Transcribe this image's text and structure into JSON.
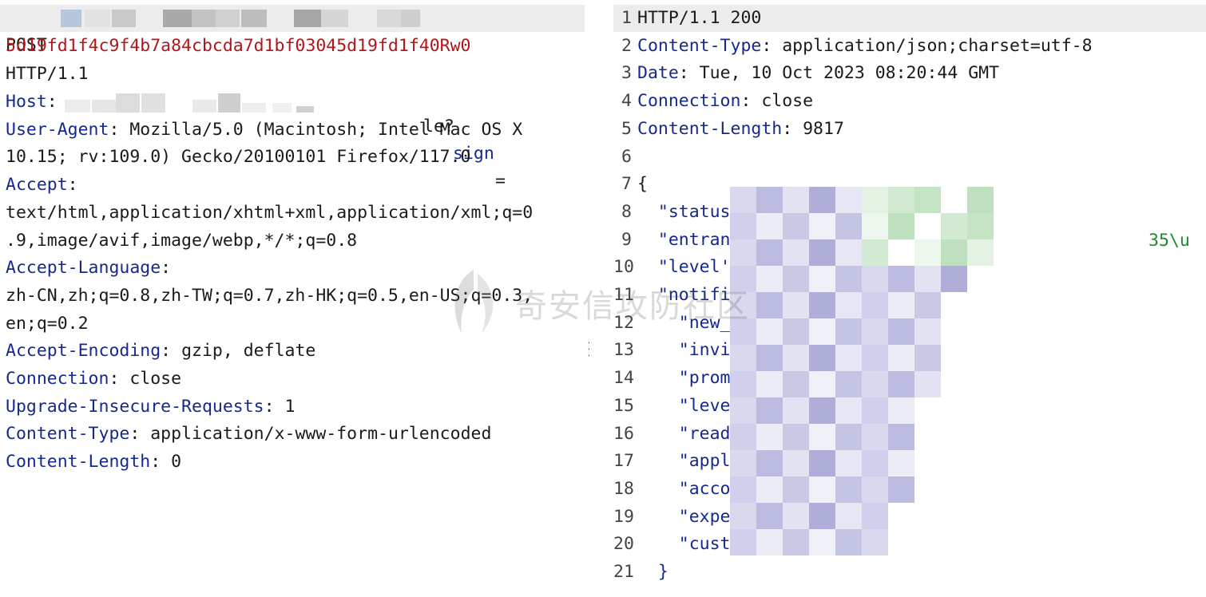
{
  "request": {
    "method": "POST",
    "url_suffix": "le?",
    "sign_param": "sign",
    "equals": "=",
    "sign_value": "5d19fd1f4c9f4b7a84cbcda7d1bf03045d19fd1f40Rw0",
    "protocol": "HTTP/1.1",
    "headers": [
      {
        "key": "Host",
        "sep": ":",
        "value": ""
      },
      {
        "key": "User-Agent",
        "sep": ":",
        "value": " Mozilla/5.0 (Macintosh; Intel Mac OS X"
      },
      {
        "key": "",
        "sep": "",
        "value": "10.15; rv:109.0) Gecko/20100101 Firefox/117.0"
      },
      {
        "key": "Accept",
        "sep": ":",
        "value": ""
      },
      {
        "key": "",
        "sep": "",
        "value": "text/html,application/xhtml+xml,application/xml;q=0"
      },
      {
        "key": "",
        "sep": "",
        "value": ".9,image/avif,image/webp,*/*;q=0.8"
      },
      {
        "key": "Accept-Language",
        "sep": ":",
        "value": ""
      },
      {
        "key": "",
        "sep": "",
        "value": "zh-CN,zh;q=0.8,zh-TW;q=0.7,zh-HK;q=0.5,en-US;q=0.3,"
      },
      {
        "key": "",
        "sep": "",
        "value": "en;q=0.2"
      },
      {
        "key": "Accept-Encoding",
        "sep": ":",
        "value": " gzip, deflate"
      },
      {
        "key": "Connection",
        "sep": ":",
        "value": " close"
      },
      {
        "key": "Upgrade-Insecure-Requests",
        "sep": ":",
        "value": " 1"
      },
      {
        "key": "Content-Type",
        "sep": ":",
        "value": " application/x-www-form-urlencoded"
      },
      {
        "key": "Content-Length",
        "sep": ":",
        "value": " 0"
      }
    ]
  },
  "response": {
    "lines": [
      {
        "n": "1",
        "key": "",
        "sep": "",
        "value": "HTTP/1.1 200"
      },
      {
        "n": "2",
        "key": "Content-Type",
        "sep": ":",
        "value": " application/json;charset=utf-8"
      },
      {
        "n": "3",
        "key": "Date",
        "sep": ":",
        "value": " Tue, 10 Oct 2023 08:20:44 GMT"
      },
      {
        "n": "4",
        "key": "Connection",
        "sep": ":",
        "value": " close"
      },
      {
        "n": "5",
        "key": "Content-Length",
        "sep": ":",
        "value": " 9817"
      },
      {
        "n": "6",
        "key": "",
        "sep": "",
        "value": ""
      },
      {
        "n": "7",
        "key": "",
        "sep": "",
        "value": "{"
      },
      {
        "n": "8",
        "key": "  \"status",
        "sep": "",
        "value": ""
      },
      {
        "n": "9",
        "key": "  \"entran",
        "sep": "",
        "value": ""
      },
      {
        "n": "10",
        "key": "  \"level'",
        "sep": "",
        "value": ""
      },
      {
        "n": "11",
        "key": "  \"notifi",
        "sep": "",
        "value": ""
      },
      {
        "n": "12",
        "key": "    \"new_",
        "sep": "",
        "value": ""
      },
      {
        "n": "13",
        "key": "    \"invi",
        "sep": "",
        "value": ""
      },
      {
        "n": "14",
        "key": "    \"prom",
        "sep": "",
        "value": ""
      },
      {
        "n": "15",
        "key": "    \"leve",
        "sep": "",
        "value": ""
      },
      {
        "n": "16",
        "key": "    \"read",
        "sep": "",
        "value": ""
      },
      {
        "n": "17",
        "key": "    \"appl",
        "sep": "",
        "value": ""
      },
      {
        "n": "18",
        "key": "    \"acco",
        "sep": "",
        "value": ""
      },
      {
        "n": "19",
        "key": "    \"expe",
        "sep": "",
        "value": ""
      },
      {
        "n": "20",
        "key": "    \"cust",
        "sep": "",
        "value": ""
      },
      {
        "n": "21",
        "key": "  }",
        "sep": "",
        "value": ""
      }
    ],
    "visible_fragment_line9": "35\\u"
  },
  "watermark": {
    "text": "奇安信攻防社区"
  },
  "colors": {
    "key": "#16288f",
    "sign": "#b3161a",
    "string": "#1d8a2e"
  }
}
